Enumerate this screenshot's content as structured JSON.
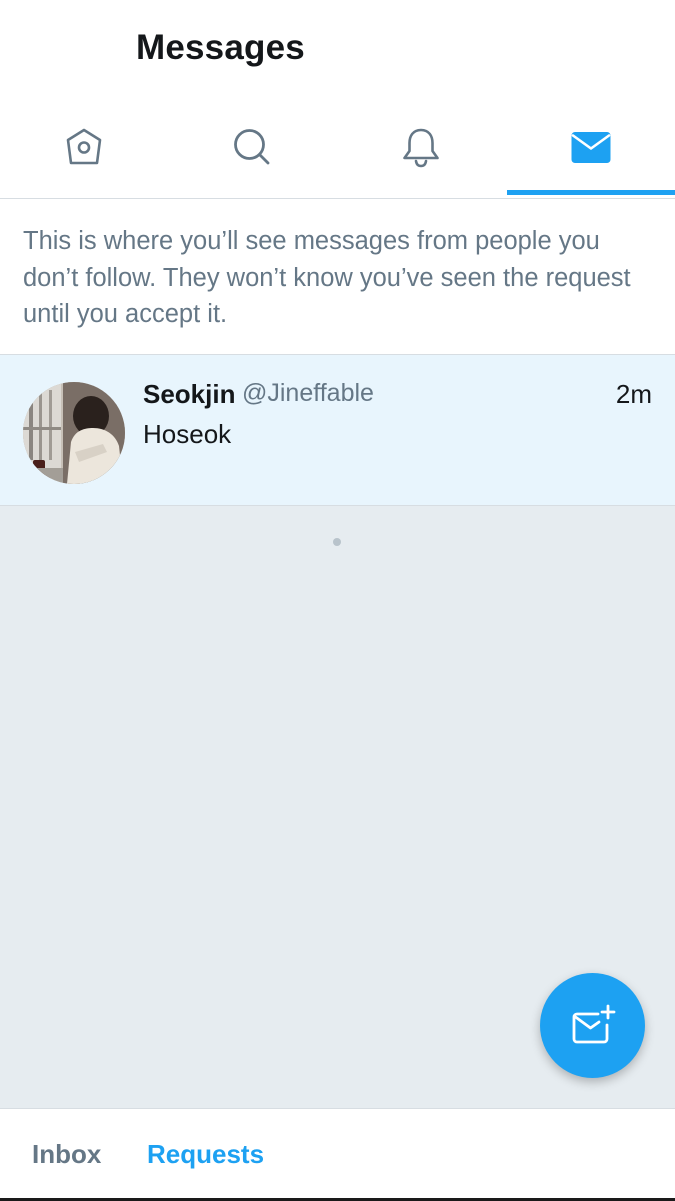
{
  "header": {
    "title": "Messages"
  },
  "tabs": [
    {
      "name": "home",
      "icon": "home-icon",
      "active": false
    },
    {
      "name": "search",
      "icon": "search-icon",
      "active": false
    },
    {
      "name": "notifications",
      "icon": "bell-icon",
      "active": false
    },
    {
      "name": "messages",
      "icon": "envelope-icon",
      "active": true
    }
  ],
  "notice": {
    "text": "This is where you’ll see messages from people you don’t follow. They won’t know you’ve seen the request until you accept it."
  },
  "requests": [
    {
      "name": "Seokjin",
      "handle": "@Jineffable",
      "time": "2m",
      "preview": "Hoseok"
    }
  ],
  "compose": {
    "icon": "compose-message-icon"
  },
  "bottom_tabs": [
    {
      "label": "Inbox",
      "active": false
    },
    {
      "label": "Requests",
      "active": true
    }
  ],
  "colors": {
    "accent": "#1da1f2",
    "muted_text": "#657786",
    "primary_text": "#14171a",
    "background": "#e6ecf0",
    "highlight_row": "#e8f5fd"
  }
}
